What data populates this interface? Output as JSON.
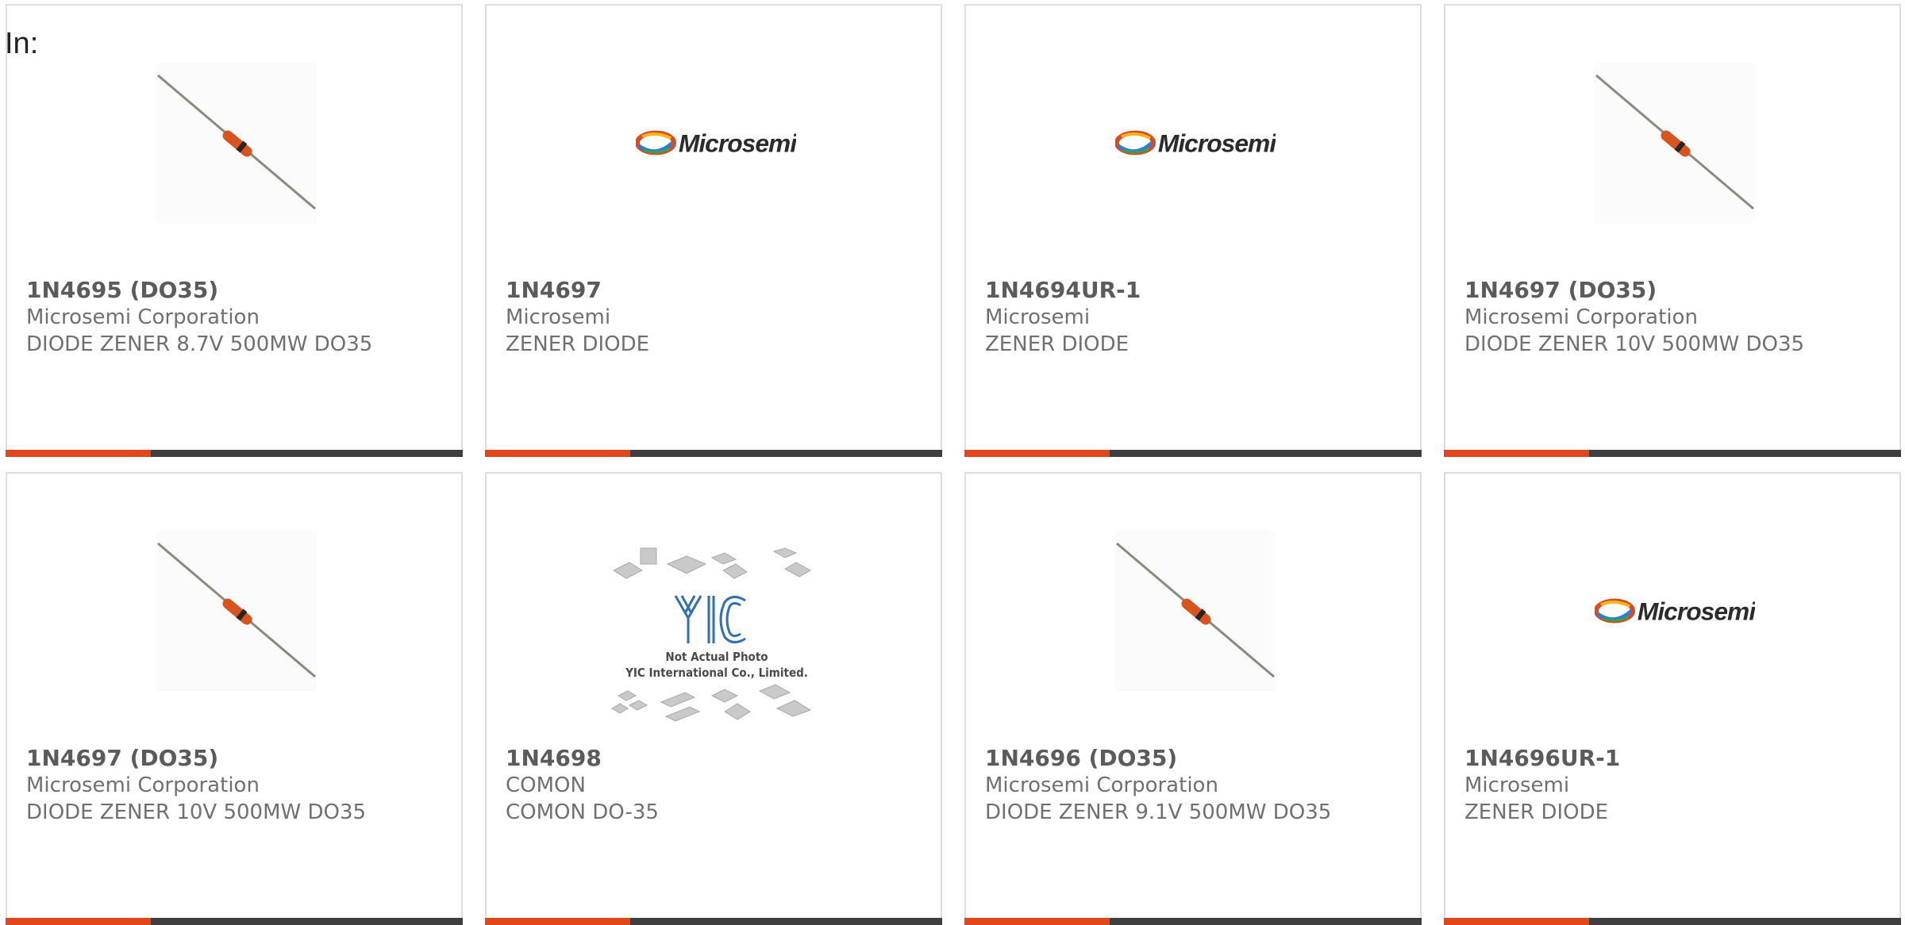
{
  "header": {
    "label": "In:"
  },
  "products": [
    {
      "part": "1N4695 (DO35)",
      "manufacturer": "Microsemi Corporation",
      "description": "DIODE ZENER 8.7V 500MW DO35",
      "image": "diode-photo"
    },
    {
      "part": "1N4697",
      "manufacturer": "Microsemi",
      "description": "ZENER DIODE",
      "image": "microsemi-logo"
    },
    {
      "part": "1N4694UR-1",
      "manufacturer": "Microsemi",
      "description": "ZENER DIODE",
      "image": "microsemi-logo"
    },
    {
      "part": "1N4697 (DO35)",
      "manufacturer": "Microsemi Corporation",
      "description": "DIODE ZENER 10V 500MW DO35",
      "image": "diode-photo"
    },
    {
      "part": "1N4697 (DO35)",
      "manufacturer": "Microsemi Corporation",
      "description": "DIODE ZENER 10V 500MW DO35",
      "image": "diode-photo"
    },
    {
      "part": "1N4698",
      "manufacturer": "COMON",
      "description": "COMON DO-35",
      "image": "yic-placeholder"
    },
    {
      "part": "1N4696 (DO35)",
      "manufacturer": "Microsemi Corporation",
      "description": "DIODE ZENER 9.1V 500MW DO35",
      "image": "diode-photo"
    },
    {
      "part": "1N4696UR-1",
      "manufacturer": "Microsemi",
      "description": "ZENER DIODE",
      "image": "microsemi-logo"
    }
  ],
  "logos": {
    "microsemi": "Microsemi",
    "yic_line1": "Not Actual Photo",
    "yic_line2": "YIC International Co., Limited.",
    "yic_mark": "YIC"
  },
  "colors": {
    "accent": "#e2461a",
    "bar": "#3f3f3f",
    "border": "#dedede",
    "text": "#707070"
  }
}
